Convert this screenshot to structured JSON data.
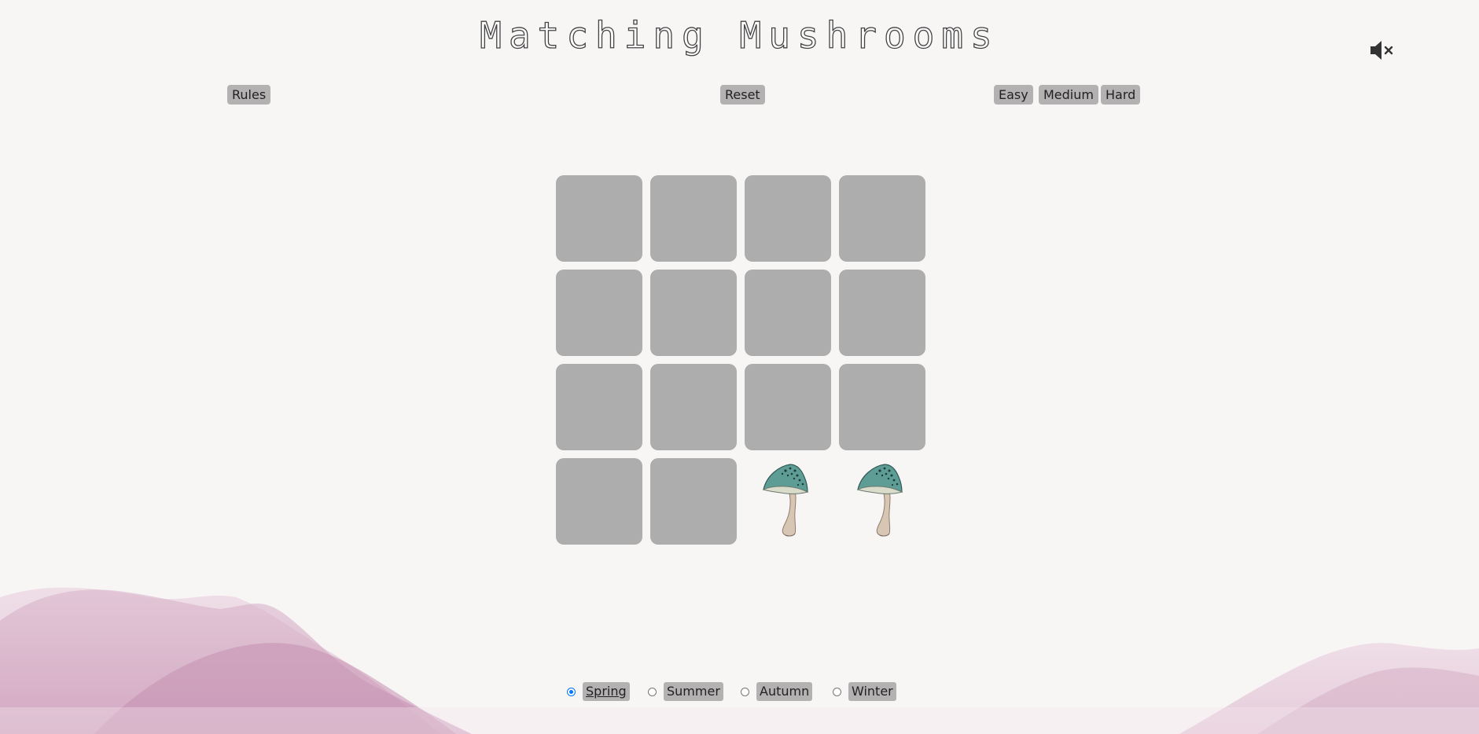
{
  "app": {
    "title": "Matching Mushrooms",
    "mute_icon": "speaker-muted-icon"
  },
  "controls": {
    "rules_label": "Rules",
    "reset_label": "Reset",
    "difficulty": [
      "Easy",
      "Medium",
      "Hard"
    ]
  },
  "board": {
    "rows": 4,
    "columns": 4,
    "cards": [
      {
        "state": "face-down"
      },
      {
        "state": "face-down"
      },
      {
        "state": "face-down"
      },
      {
        "state": "face-down"
      },
      {
        "state": "face-down"
      },
      {
        "state": "face-down"
      },
      {
        "state": "face-down"
      },
      {
        "state": "face-down"
      },
      {
        "state": "face-down"
      },
      {
        "state": "face-down"
      },
      {
        "state": "face-down"
      },
      {
        "state": "face-down"
      },
      {
        "state": "face-down"
      },
      {
        "state": "face-down"
      },
      {
        "state": "face-up",
        "image": "teal-mushroom-icon"
      },
      {
        "state": "face-up",
        "image": "teal-mushroom-icon"
      }
    ]
  },
  "seasons": {
    "options": [
      "Spring",
      "Summer",
      "Autumn",
      "Winter"
    ],
    "selected": "Spring"
  },
  "colors": {
    "card_back": "#adadad",
    "button_bg": "#b3b1b1",
    "mushroom_cap": "#5e9d95",
    "hills": "#d8aec8"
  }
}
